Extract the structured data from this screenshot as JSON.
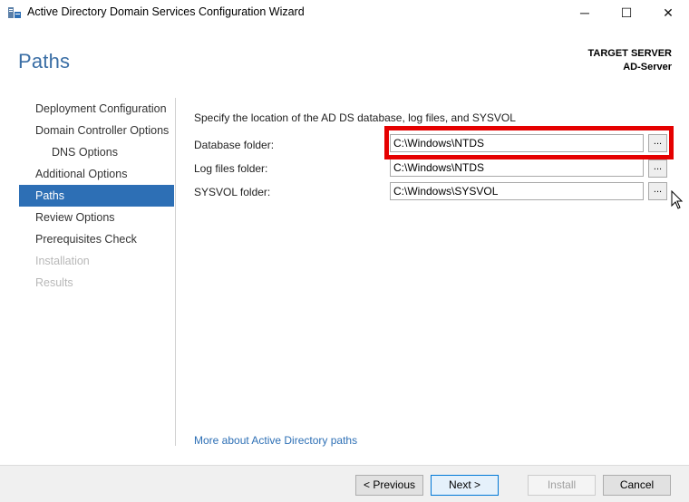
{
  "window": {
    "title": "Active Directory Domain Services Configuration Wizard",
    "icon": "server-manager-icon",
    "controls": {
      "minimize": "─",
      "maximize": "☐",
      "close": "✕"
    }
  },
  "header": {
    "page_title": "Paths",
    "target_label": "TARGET SERVER",
    "target_value": "AD-Server"
  },
  "nav": {
    "items": [
      {
        "label": "Deployment Configuration",
        "state": "normal"
      },
      {
        "label": "Domain Controller Options",
        "state": "normal"
      },
      {
        "label": "DNS Options",
        "state": "sub"
      },
      {
        "label": "Additional Options",
        "state": "normal"
      },
      {
        "label": "Paths",
        "state": "active"
      },
      {
        "label": "Review Options",
        "state": "normal"
      },
      {
        "label": "Prerequisites Check",
        "state": "normal"
      },
      {
        "label": "Installation",
        "state": "disabled"
      },
      {
        "label": "Results",
        "state": "disabled"
      }
    ]
  },
  "content": {
    "intro": "Specify the location of the AD DS database, log files, and SYSVOL",
    "rows": [
      {
        "label": "Database folder:",
        "value": "C:\\Windows\\NTDS",
        "browse": "..."
      },
      {
        "label": "Log files folder:",
        "value": "C:\\Windows\\NTDS",
        "browse": "..."
      },
      {
        "label": "SYSVOL folder:",
        "value": "C:\\Windows\\SYSVOL",
        "browse": "..."
      }
    ],
    "more_link": "More about Active Directory paths"
  },
  "footer": {
    "previous": "< Previous",
    "next": "Next >",
    "install": "Install",
    "cancel": "Cancel"
  },
  "colors": {
    "accent": "#2d6fb5",
    "title": "#3a6ea5",
    "highlight": "#e50000"
  }
}
